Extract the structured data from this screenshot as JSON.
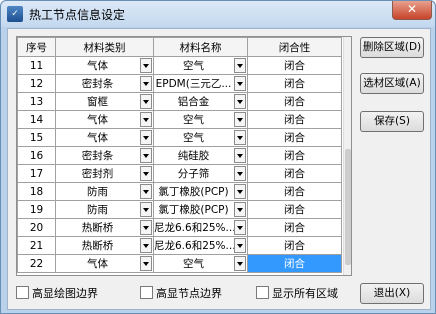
{
  "window": {
    "title": "热工节点信息设定",
    "close_symbol": "✕",
    "app_icon_text": "✓"
  },
  "grid": {
    "headers": [
      "序号",
      "材料类别",
      "材料名称",
      "闭合性"
    ],
    "rows": [
      {
        "no": "11",
        "category": "气体",
        "name": "空气",
        "closure": "闭合"
      },
      {
        "no": "12",
        "category": "密封条",
        "name": "EPDM(三元乙...",
        "closure": "闭合"
      },
      {
        "no": "13",
        "category": "窗框",
        "name": "铝合金",
        "closure": "闭合"
      },
      {
        "no": "14",
        "category": "气体",
        "name": "空气",
        "closure": "闭合"
      },
      {
        "no": "15",
        "category": "气体",
        "name": "空气",
        "closure": "闭合"
      },
      {
        "no": "16",
        "category": "密封条",
        "name": "纯硅胶",
        "closure": "闭合"
      },
      {
        "no": "17",
        "category": "密封剂",
        "name": "分子筛",
        "closure": "闭合"
      },
      {
        "no": "18",
        "category": "防雨",
        "name": "氯丁橡胶(PCP)",
        "closure": "闭合"
      },
      {
        "no": "19",
        "category": "防雨",
        "name": "氯丁橡胶(PCP)",
        "closure": "闭合"
      },
      {
        "no": "20",
        "category": "热断桥",
        "name": "尼龙6.6和25%...",
        "closure": "闭合"
      },
      {
        "no": "21",
        "category": "热断桥",
        "name": "尼龙6.6和25%...",
        "closure": "闭合"
      },
      {
        "no": "22",
        "category": "气体",
        "name": "空气",
        "closure": "闭合"
      }
    ]
  },
  "buttons": {
    "delete": "删除区域(D)",
    "select": "选材区域(A)",
    "save": "保存(S)",
    "exit": "退出(X)"
  },
  "checkboxes": {
    "highlight_draw_border": "高显绘图边界",
    "highlight_node_border": "高显节点边界",
    "show_all_regions": "显示所有区域"
  },
  "colors": {
    "selected": "#3399ff",
    "title_bg": "#c3d8ef"
  }
}
